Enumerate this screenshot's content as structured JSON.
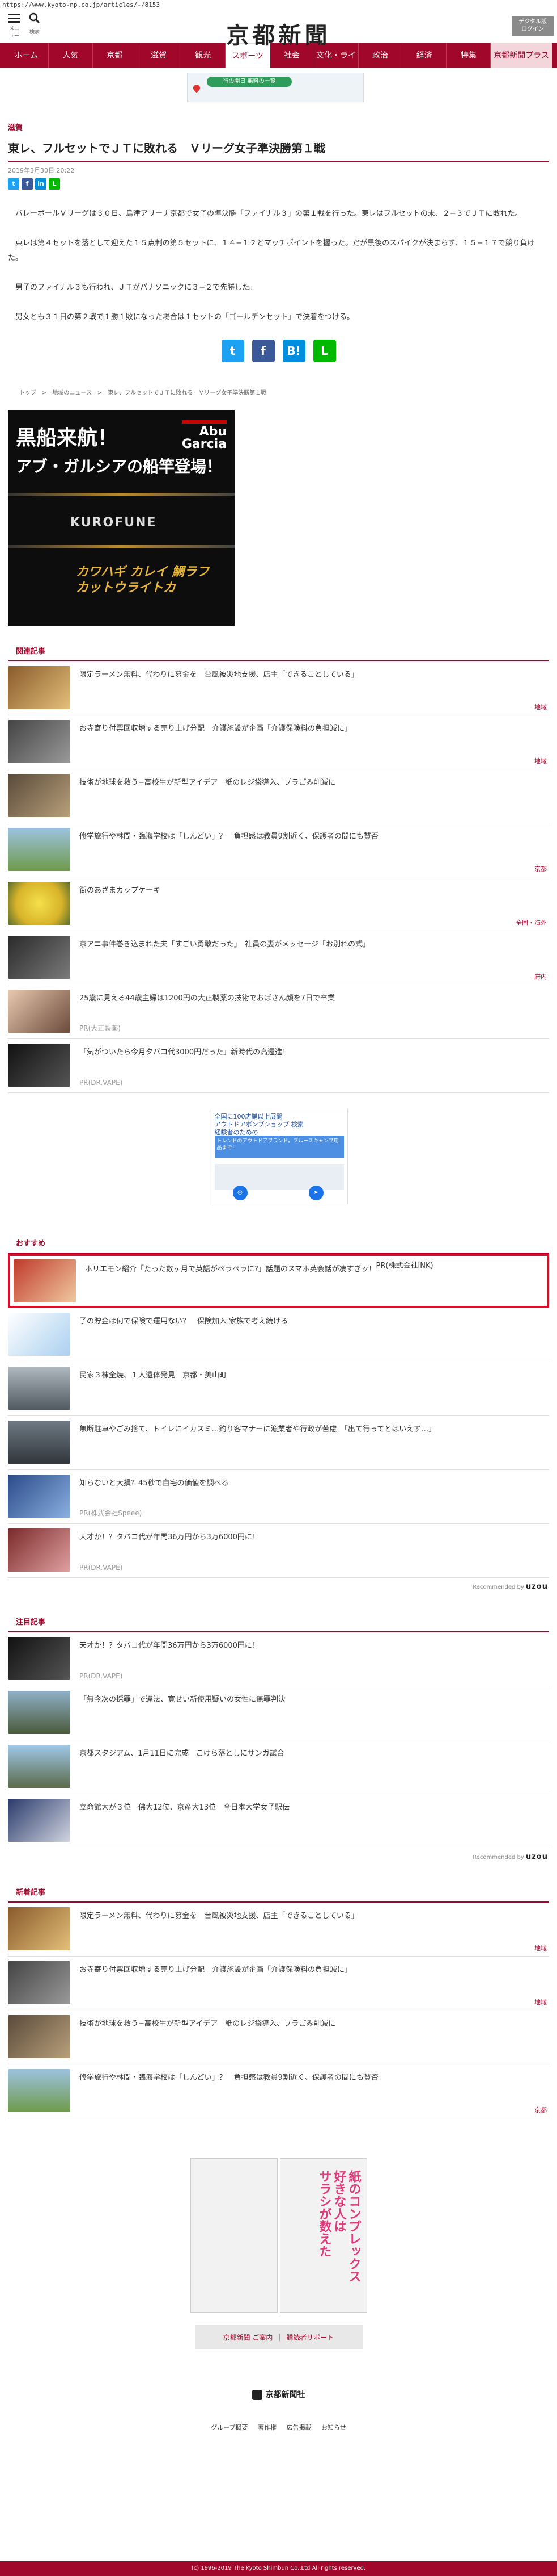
{
  "url": "https://www.kyoto-np.co.jp/articles/-/8153",
  "header": {
    "menu_label": "メニュー",
    "search_label": "検索",
    "logo": "京都新聞",
    "digital_label": "デジタル版\nログイン"
  },
  "nav": [
    "ホーム",
    "人気",
    "京都",
    "滋賀",
    "観光",
    "スポーツ",
    "社会",
    "文化・ライフ",
    "政治",
    "経済",
    "特集",
    "京都新聞プラス"
  ],
  "ad_top": {
    "pill": "行の開日 無料の一覧"
  },
  "article": {
    "category": "滋賀",
    "title": "東レ、フルセットでＪＴに敗れる　Ｖリーグ女子準決勝第１戦",
    "date": "2019年3月30日 20:22",
    "paragraphs": [
      "バレーボールＶリーグは３０日、島津アリーナ京都で女子の準決勝「ファイナル３」の第１戦を行った。東レはフルセットの末、２−３でＪＴに敗れた。",
      "東レは第４セットを落として迎えた１５点制の第５セットに、１４−１２とマッチポイントを握った。だが黒後のスパイクが決まらず、１５−１７で競り負けた。",
      "男子のファイナル３も行われ、ＪＴがパナソニックに３−２で先勝した。",
      "男女とも３１日の第２戦で１勝１敗になった場合は１セットの「ゴールデンセット」で決着をつける。"
    ],
    "breadcrumb": "トップ　>　地域のニュース　>　東レ、フルセットでＪＴに敗れる　Ｖリーグ女子準決勝第１戦"
  },
  "big_ad": {
    "line1": "黒船来航！",
    "line2": "アブ・ガルシアの船竿登場！",
    "brand": "Abu\nGarcia",
    "product": "KUROFUNE",
    "sub": "カワハギ カレイ 鯛ラフ\nカットウライトカ"
  },
  "related": {
    "heading": "関連記事",
    "items": [
      {
        "title": "限定ラーメン無料、代わりに募金を　台風被災地支援、店主「できることしている」",
        "tag": "地域"
      },
      {
        "title": "お寺寄り付票回収増する売り上げ分配　介護施設が企画「介護保険料の負担減に」",
        "tag": "地域"
      },
      {
        "title": "技術が地球を救う−高校生が新型アイデア　紙のレジ袋導入、プラごみ削減に",
        "tag": ""
      },
      {
        "title": "修学旅行や林間・臨海学校は「しんどい」？　負担感は教員9割近く、保護者の間にも賛否",
        "tag": "京都"
      },
      {
        "title": "街のあざまカップケーキ",
        "tag": "全国・海外"
      },
      {
        "title": "京アニ事件巻き込まれた夫「すごい勇敢だった」　社員の妻がメッセージ「お別れの式」",
        "tag": "府内"
      },
      {
        "title": "25歳に見える44歳主婦は1200円の大正製薬の技術でおばさん顔を7日で卒業",
        "pr": "PR(大正製薬)"
      },
      {
        "title": "「気がついたら今月タバコ代3000円だった」新時代の高還進！",
        "pr": "PR(DR.VAPE)"
      }
    ]
  },
  "mid_ad": {
    "headline": "全国に100店舗以上展開\nアウトドアポンプショップ 検索\n経験者のための",
    "blue": "トレンドのアウトドアブランド。ブルースキャンプ用品まで！",
    "buttons": [
      "ウェブサイト",
      "ルート"
    ]
  },
  "recommend": {
    "heading": "おすすめ",
    "highlight": {
      "title": "ホリエモン紹介「たった数ヶ月で英語がペラペラに?」話題のスマホ英会話が凄すぎッ！",
      "pr": "PR(株式会社INK)"
    },
    "items": [
      {
        "title": "子の貯金は何で保険で運用ない？　保険加入 家族で考え続ける"
      },
      {
        "title": "民家３棟全焼、１人遺体発見　京都・美山町"
      },
      {
        "title": "無断駐車やごみ捨て、トイレにイカスミ…釣り客マナーに漁業者や行政が苦慮　「出て行ってとはいえず…」"
      },
      {
        "title": "知らないと大損？45秒で自宅の価値を調べる",
        "pr": "PR(株式会社Speee)"
      },
      {
        "title": "天才か！？タバコ代が年間36万円から3万6000円に！",
        "pr": "PR(DR.VAPE)"
      }
    ],
    "recommended_by": "Recommended by",
    "brand": "uzou"
  },
  "attention": {
    "heading": "注目記事",
    "items": [
      {
        "title": "天才か！？タバコ代が年間36万円から3万6000円に！",
        "pr": "PR(DR.VAPE)"
      },
      {
        "title": "「無今次の採罪」で違法、寛せい新使用疑いの女性に無罪判決"
      },
      {
        "title": "京都スタジアム、1月11日に完成　こけら落としにサンガ試合"
      },
      {
        "title": "立命館大が３位　佛大12位、京産大13位　全日本大学女子駅伝"
      }
    ],
    "recommended_by": "Recommended by",
    "brand": "uzou"
  },
  "latest": {
    "heading": "新着記事",
    "items": [
      {
        "title": "限定ラーメン無料、代わりに募金を　台風被災地支援、店主「できることしている」",
        "tag": "地域"
      },
      {
        "title": "お寺寄り付票回収増する売り上げ分配　介護施設が企画「介護保険料の負担減に」",
        "tag": "地域"
      },
      {
        "title": "技術が地球を救う−高校生が新型アイデア　紙のレジ袋導入、プラごみ削減に",
        "tag": ""
      },
      {
        "title": "修学旅行や林間・臨海学校は「しんどい」？　負担感は教員9割近く、保護者の間にも賛否",
        "tag": "京都"
      }
    ]
  },
  "manga_ad": {
    "text": "紙のコンプレックス\n好きな人は\nサラシが数えた"
  },
  "footer": {
    "link1": "京都新聞 ご案内",
    "link2": "購読者サポート",
    "logo": "京都新聞社",
    "links": "グループ概要 著作権 広告掲載 お知らせ",
    "copyright": "(c) 1996-2019 The Kyoto Shimbun Co.,Ltd All rights reserved."
  },
  "colors": {
    "accent": "#a1072b",
    "highlight_border": "#d3112a"
  }
}
